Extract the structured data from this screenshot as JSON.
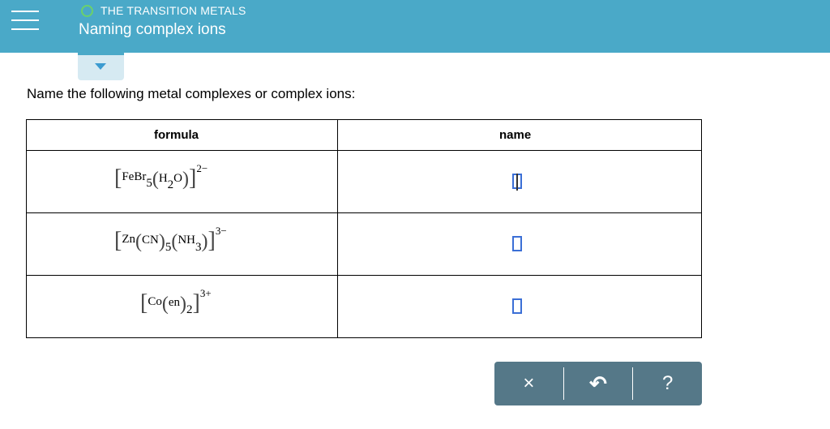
{
  "header": {
    "topic": "THE TRANSITION METALS",
    "title": "Naming complex ions"
  },
  "prompt": "Name the following metal complexes or complex ions:",
  "table": {
    "headers": [
      "formula",
      "name"
    ],
    "rows": [
      {
        "open": "[",
        "core": "FeBr",
        "core_sub": "5",
        "lig_open": "(",
        "lig": "H",
        "lig_sub": "2",
        "lig_rest": "O",
        "lig_close": ")",
        "close": "]",
        "charge": "2−"
      },
      {
        "open": "[",
        "core": "Zn",
        "lig1_open": "(",
        "lig1": "CN",
        "lig1_close": ")",
        "lig1_sub": "5",
        "lig_open": "(",
        "lig": "NH",
        "lig_sub": "3",
        "lig_close": ")",
        "close": "]",
        "charge": "3−"
      },
      {
        "open": "[",
        "core": "Co",
        "lig_open": "(",
        "lig": "en",
        "lig_close": ")",
        "lig_sub": "2",
        "close": "]",
        "charge": "3+"
      }
    ]
  },
  "toolbar": {
    "clear_symbol": "×",
    "undo_symbol": "↶",
    "help_symbol": "?"
  }
}
